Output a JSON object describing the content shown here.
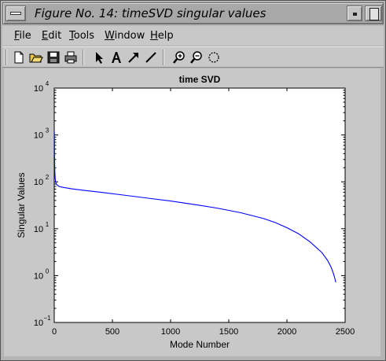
{
  "window": {
    "title": "Figure No. 14: timeSVD singular values"
  },
  "menubar": {
    "items": [
      {
        "label": "File",
        "mnemonic": "F",
        "rest": "ile"
      },
      {
        "label": "Edit",
        "mnemonic": "E",
        "rest": "dit"
      },
      {
        "label": "Tools",
        "mnemonic": "T",
        "rest": "ools"
      },
      {
        "label": "Window",
        "mnemonic": "W",
        "rest": "indow"
      },
      {
        "label": "Help",
        "mnemonic": "H",
        "rest": "elp"
      }
    ]
  },
  "toolbar": {
    "icons": [
      "new-file-icon",
      "open-folder-icon",
      "save-icon",
      "print-icon",
      "select-arrow-icon",
      "text-tool-icon",
      "arrow-tool-icon",
      "line-tool-icon",
      "zoom-in-icon",
      "zoom-out-icon",
      "rotate-icon"
    ]
  },
  "chart_data": {
    "type": "line",
    "title": "time SVD",
    "xlabel": "Mode Number",
    "ylabel": "Singular Values",
    "xlim": [
      0,
      2500
    ],
    "ylim": [
      0.1,
      10000
    ],
    "yscale": "log",
    "x_ticks": [
      "0",
      "500",
      "1000",
      "1500",
      "2000",
      "2500"
    ],
    "y_ticks": [
      {
        "base": "10",
        "exp": "−1",
        "value": 0.1
      },
      {
        "base": "10",
        "exp": "0",
        "value": 1
      },
      {
        "base": "10",
        "exp": "1",
        "value": 10
      },
      {
        "base": "10",
        "exp": "2",
        "value": 100
      },
      {
        "base": "10",
        "exp": "3",
        "value": 1000
      },
      {
        "base": "10",
        "exp": "4",
        "value": 10000
      }
    ],
    "grid": false,
    "series": [
      {
        "color": "#0000ff",
        "x": [
          1,
          3,
          5,
          8,
          12,
          20,
          40,
          80,
          150,
          250,
          400,
          600,
          800,
          1000,
          1200,
          1400,
          1600,
          1800,
          1900,
          2000,
          2100,
          2200,
          2300,
          2350,
          2380,
          2400,
          2410,
          2420
        ],
        "y": [
          1200,
          300,
          170,
          120,
          100,
          88,
          80,
          76,
          71,
          66,
          60,
          52,
          45,
          39,
          33,
          27.5,
          22,
          16.5,
          13.5,
          10.5,
          7.8,
          5.2,
          3.1,
          2.1,
          1.5,
          1.1,
          0.9,
          0.72
        ]
      }
    ]
  }
}
